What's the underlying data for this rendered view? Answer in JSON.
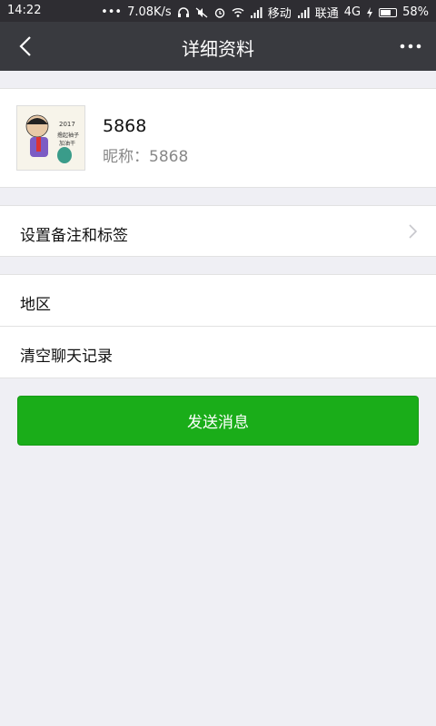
{
  "status_bar": {
    "time": "14:22",
    "speed": "7.08K/s",
    "carrier1": "移动",
    "carrier2": "联通",
    "network": "4G",
    "battery": "58%",
    "battery_level": 0.58
  },
  "toolbar": {
    "title": "详细资料"
  },
  "profile": {
    "name": "5868",
    "nickname": "昵称：5868"
  },
  "rows": {
    "remark_tags": "设置备注和标签",
    "region": "地区",
    "clear_chat": "清空聊天记录"
  },
  "actions": {
    "send_message": "发送消息"
  },
  "colors": {
    "accent_green": "#1aad19",
    "toolbar_bg": "#393a3f",
    "page_bg": "#efeff4"
  }
}
